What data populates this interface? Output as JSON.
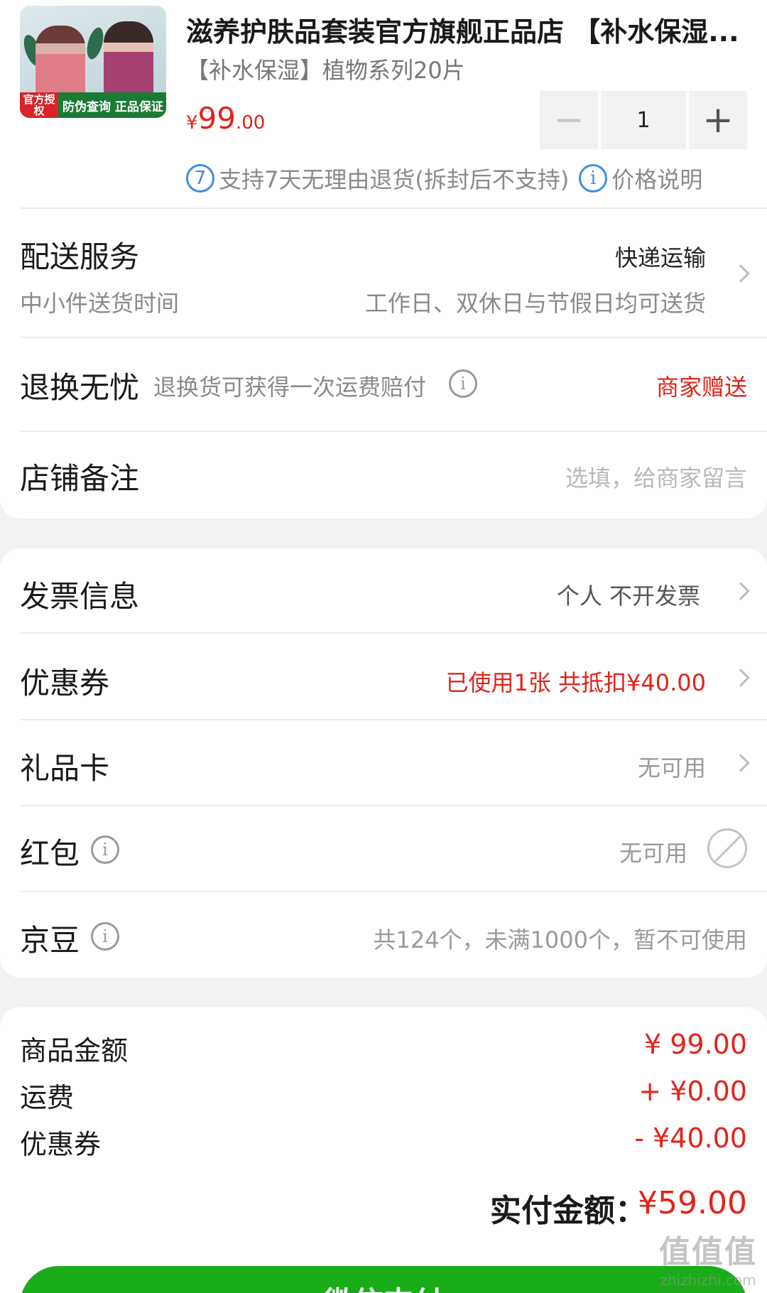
{
  "product": {
    "title": "滋养护肤品套装官方旗舰正品店 【补水保湿...",
    "variant": "【补水保湿】植物系列20片",
    "price_currency": "¥",
    "price_int": "99",
    "price_dec": ".00",
    "quantity": "1",
    "minus_symbol": "−",
    "plus_symbol": "+",
    "image_badge_left": "官方授权",
    "image_badge_right": "防伪查询 正品保证",
    "return_policy": "支持7天无理由退货(拆封后不支持)",
    "return_icon_text": "7",
    "price_note": "价格说明",
    "info_symbol": "i"
  },
  "delivery": {
    "label": "配送服务",
    "method": "快递运输",
    "sub_label": "中小件送货时间",
    "sub_value": "工作日、双休日与节假日均可送货"
  },
  "exchange": {
    "label": "退换无忧",
    "desc": "退换货可获得一次运费赔付",
    "value": "商家赠送"
  },
  "remark": {
    "label": "店铺备注",
    "placeholder": "选填，给商家留言"
  },
  "invoice": {
    "label": "发票信息",
    "value": "个人 不开发票"
  },
  "coupon": {
    "label": "优惠券",
    "value": "已使用1张 共抵扣¥40.00"
  },
  "giftcard": {
    "label": "礼品卡",
    "value": "无可用"
  },
  "redpacket": {
    "label": "红包",
    "value": "无可用"
  },
  "jingdou": {
    "label": "京豆",
    "value": "共124个，未满1000个，暂不可使用"
  },
  "summary": {
    "goods_label": "商品金额",
    "goods_value": "¥ 99.00",
    "shipping_label": "运费",
    "shipping_value": "+ ¥0.00",
    "coupon_label": "优惠券",
    "coupon_value": "- ¥40.00",
    "pay_label": "实付金额：",
    "pay_value": "¥59.00"
  },
  "pay_button": "微信支付",
  "watermark": {
    "logo": "值值值",
    "site": "zhizhizhi.com"
  },
  "colors": {
    "accent_red": "#e2231a",
    "pay_green": "#1aad19",
    "info_blue": "#3a8ee6"
  }
}
